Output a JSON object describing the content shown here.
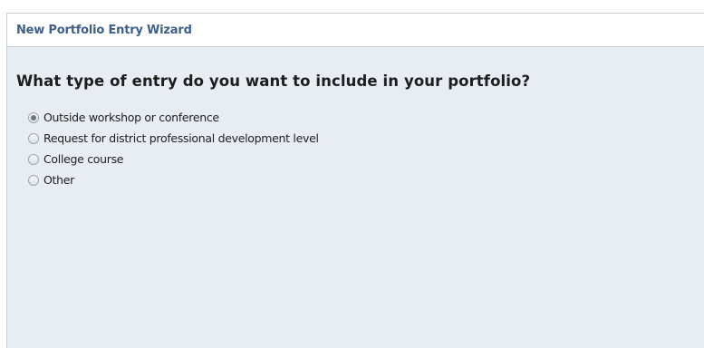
{
  "wizard": {
    "title": "New Portfolio Entry Wizard",
    "question": "What type of entry do you want to include in your portfolio?",
    "selected_index": 0,
    "options": [
      {
        "label": "Outside workshop or conference",
        "checked": true
      },
      {
        "label": "Request for district professional development level",
        "checked": false
      },
      {
        "label": "College course",
        "checked": false
      },
      {
        "label": "Other",
        "checked": false
      }
    ]
  }
}
